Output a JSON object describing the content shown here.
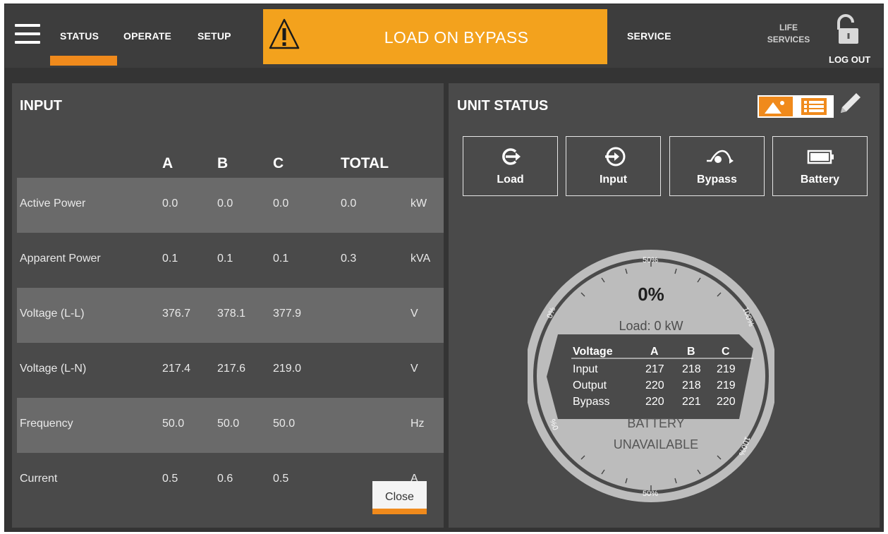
{
  "nav": {
    "items": [
      "STATUS",
      "OPERATE",
      "SETUP",
      "SERVICE"
    ],
    "active": "STATUS"
  },
  "alarm": {
    "text": "LOAD ON BYPASS",
    "icon": "warning-triangle-icon",
    "color": "#f3a21d"
  },
  "header_right": {
    "life_services_line1": "LIFE",
    "life_services_line2": "SERVICES",
    "logout": "LOG OUT",
    "lock_icon": "unlocked-padlock-icon"
  },
  "input_panel": {
    "title": "INPUT",
    "columns": [
      "A",
      "B",
      "C",
      "TOTAL"
    ],
    "rows": [
      {
        "label": "Active Power",
        "a": "0.0",
        "b": "0.0",
        "c": "0.0",
        "total": "0.0",
        "unit": "kW"
      },
      {
        "label": "Apparent Power",
        "a": "0.1",
        "b": "0.1",
        "c": "0.1",
        "total": "0.3",
        "unit": "kVA"
      },
      {
        "label": "Voltage (L-L)",
        "a": "376.7",
        "b": "378.1",
        "c": "377.9",
        "total": "",
        "unit": "V"
      },
      {
        "label": "Voltage (L-N)",
        "a": "217.4",
        "b": "217.6",
        "c": "219.0",
        "total": "",
        "unit": "V"
      },
      {
        "label": "Frequency",
        "a": "50.0",
        "b": "50.0",
        "c": "50.0",
        "total": "",
        "unit": "Hz"
      },
      {
        "label": "Current",
        "a": "0.5",
        "b": "0.6",
        "c": "0.5",
        "total": "",
        "unit": "A"
      }
    ],
    "close_label": "Close"
  },
  "unit_panel": {
    "title": "UNIT STATUS",
    "tiles": [
      {
        "label": "Load",
        "icon": "load-arrow-icon"
      },
      {
        "label": "Input",
        "icon": "input-arrow-icon"
      },
      {
        "label": "Bypass",
        "icon": "bypass-arc-icon"
      },
      {
        "label": "Battery",
        "icon": "battery-icon"
      }
    ],
    "gauge": {
      "percent": "0%",
      "load_text": "Load: 0 kW",
      "scale_top": "50%",
      "scale_bottom": "50%",
      "scale_left_top": "0%",
      "scale_right_top": "100%",
      "scale_left_bottom": "0%",
      "scale_right_bottom": "100%",
      "voltage_table": {
        "headers": [
          "Voltage",
          "A",
          "B",
          "C"
        ],
        "rows": [
          {
            "label": "Input",
            "values": [
              "217",
              "218",
              "219"
            ]
          },
          {
            "label": "Output",
            "values": [
              "220",
              "218",
              "219"
            ]
          },
          {
            "label": "Bypass",
            "values": [
              "220",
              "221",
              "220"
            ]
          }
        ]
      },
      "battery_line1": "BATTERY",
      "battery_line2": "UNAVAILABLE"
    }
  },
  "colors": {
    "accent": "#f08a1c",
    "panel": "#4a4a4a",
    "row_shade": "#6a6a6a",
    "gauge": "#bcbcbc"
  }
}
